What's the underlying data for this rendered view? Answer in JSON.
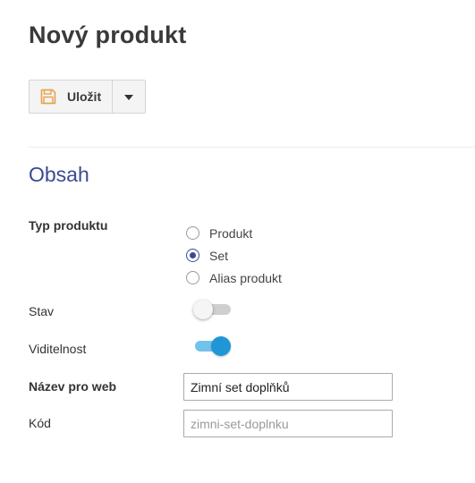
{
  "page": {
    "title": "Nový produkt"
  },
  "toolbar": {
    "save_label": "Uložit",
    "save_icon": "floppy-disk-icon",
    "dropdown_icon": "caret-down-icon",
    "accent": "#e8a24a"
  },
  "section": {
    "title": "Obsah",
    "color": "#3c4a92"
  },
  "product_type": {
    "label": "Typ produktu",
    "options": [
      {
        "label": "Produkt",
        "checked": false
      },
      {
        "label": "Set",
        "checked": true
      },
      {
        "label": "Alias produkt",
        "checked": false
      }
    ]
  },
  "status": {
    "label": "Stav",
    "on": false
  },
  "visibility": {
    "label": "Viditelnost",
    "on": true
  },
  "web_name": {
    "label": "Název pro web",
    "value": "Zimní set doplňků"
  },
  "code": {
    "label": "Kód",
    "placeholder": "zimni-set-doplnku",
    "value": ""
  },
  "colors": {
    "toggle_on": "#2196d6",
    "radio_checked": "#3c4a92"
  }
}
